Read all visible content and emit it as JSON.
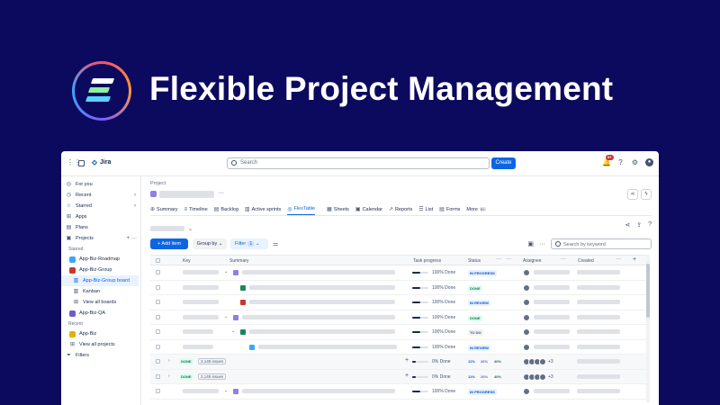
{
  "hero": {
    "title": "Flexible Project Management"
  },
  "topbar": {
    "app_name": "Jira",
    "search_placeholder": "Search",
    "create_label": "Create",
    "notif_count": "9+"
  },
  "sidebar": {
    "items": [
      {
        "label": "For you"
      },
      {
        "label": "Recent"
      },
      {
        "label": "Starred"
      },
      {
        "label": "Apps"
      },
      {
        "label": "Plans"
      },
      {
        "label": "Projects"
      }
    ],
    "starred_heading": "Starred",
    "starred": [
      {
        "label": "App-Biz-Roadmap",
        "color": "#3da5ff"
      },
      {
        "label": "App-Biz-Group",
        "color": "#c9372c"
      },
      {
        "label": "App-Biz-Group board"
      },
      {
        "label": "Kanban"
      },
      {
        "label": "View all boards"
      },
      {
        "label": "App-Biz-QA",
        "color": "#1f845a"
      }
    ],
    "recent_heading": "Recent",
    "recent": [
      {
        "label": "App-Biz",
        "color": "#e2b203"
      }
    ],
    "view_all_projects": "View all projects",
    "filters": "Filters"
  },
  "main": {
    "breadcrumb": "Project",
    "tabs": [
      {
        "label": "Summary",
        "icon": "globe-icon"
      },
      {
        "label": "Timeline",
        "icon": "timeline-icon"
      },
      {
        "label": "Backlog",
        "icon": "backlog-icon"
      },
      {
        "label": "Active sprints",
        "icon": "sprint-icon"
      },
      {
        "label": "FlexTable",
        "icon": "flextable-icon",
        "active": true
      },
      {
        "label": "Sheets",
        "icon": "sheets-icon"
      },
      {
        "label": "Calendar",
        "icon": "calendar-icon"
      },
      {
        "label": "Reports",
        "icon": "reports-icon"
      },
      {
        "label": "List",
        "icon": "list-icon"
      },
      {
        "label": "Forms",
        "icon": "forms-icon"
      },
      {
        "label": "More",
        "badge": "9+"
      }
    ],
    "toolbar": {
      "add_label": "+ Add item",
      "group_label": "Group by",
      "filter_label": "Filter",
      "filter_count": "1",
      "search_placeholder": "Search by keyword"
    },
    "columns": {
      "key": "Key",
      "summary": "Summary",
      "progress": "Task progress",
      "status": "Status",
      "assignee": "Assignee",
      "created": "Created"
    }
  },
  "rows": [
    {
      "progress": "100% Done",
      "status": "IN PROGRESS",
      "status_kind": "progress",
      "type_color": "#8f7ee7",
      "expand": true
    },
    {
      "progress": "100% Done",
      "status": "DONE",
      "status_kind": "done",
      "type_color": "#1f845a"
    },
    {
      "progress": "100% Done",
      "status": "IN REVIEW",
      "status_kind": "review",
      "type_color": "#c9372c"
    },
    {
      "progress": "100% Done",
      "status": "DONE",
      "status_kind": "done",
      "type_color": "#8f7ee7",
      "expand": true
    },
    {
      "progress": "100% Done",
      "status": "TO DO",
      "status_kind": "todo",
      "type_color": "#1f845a",
      "expand": true
    },
    {
      "progress": "100% Done",
      "status": "IN REVIEW",
      "status_kind": "review",
      "type_color": "#3da5ff"
    }
  ],
  "groups": [
    {
      "done": "DONE",
      "count": "2,145 issues",
      "progress": "0% Done",
      "segs": [
        "11%",
        "26%",
        "40%"
      ],
      "more": "+3"
    },
    {
      "done": "DONE",
      "count": "2,145 issues",
      "progress": "0% Done",
      "segs": [
        "11%",
        "26%",
        "40%"
      ],
      "more": "+3"
    }
  ],
  "last_row": {
    "progress": "100% Done",
    "status": "IN PROGRESS",
    "type_color": "#8f7ee7"
  },
  "colors": {
    "background": "#0c0a5e",
    "accent": "#0c66e4"
  }
}
